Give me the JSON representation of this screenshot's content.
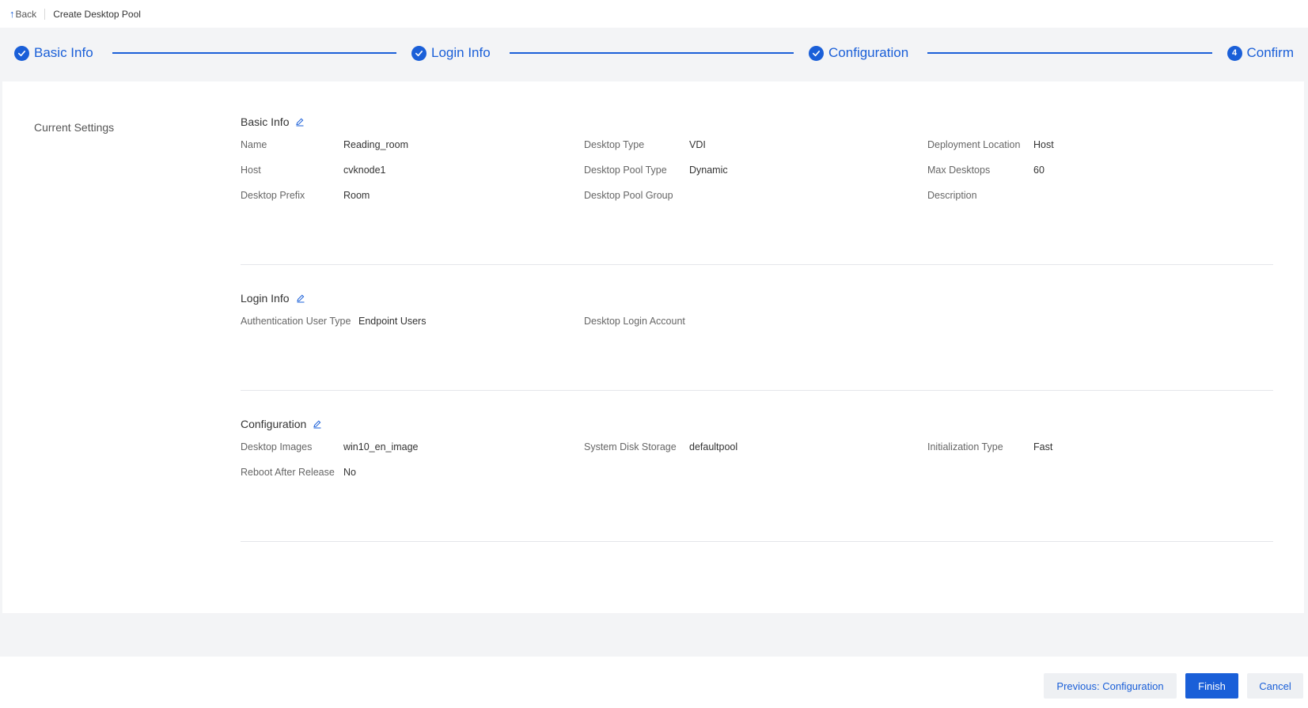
{
  "topbar": {
    "back_label": "Back",
    "page_title": "Create Desktop Pool"
  },
  "steps": [
    {
      "label": "Basic Info",
      "status": "done"
    },
    {
      "label": "Login Info",
      "status": "done"
    },
    {
      "label": "Configuration",
      "status": "done"
    },
    {
      "label": "Confirm",
      "status": "current",
      "number": "4"
    }
  ],
  "side_title": "Current Settings",
  "sections": {
    "basic_info": {
      "title": "Basic Info",
      "name_label": "Name",
      "name_value": "Reading_room",
      "desktop_type_label": "Desktop Type",
      "desktop_type_value": "VDI",
      "deployment_location_label": "Deployment Location",
      "deployment_location_value": "Host",
      "host_label": "Host",
      "host_value": "cvknode1",
      "pool_type_label": "Desktop Pool Type",
      "pool_type_value": "Dynamic",
      "max_desktops_label": "Max Desktops",
      "max_desktops_value": "60",
      "prefix_label": "Desktop Prefix",
      "prefix_value": "Room",
      "pool_group_label": "Desktop Pool Group",
      "pool_group_value": "",
      "description_label": "Description",
      "description_value": ""
    },
    "login_info": {
      "title": "Login Info",
      "auth_type_label": "Authentication User Type",
      "auth_type_value": "Endpoint Users",
      "login_account_label": "Desktop Login Account",
      "login_account_value": ""
    },
    "configuration": {
      "title": "Configuration",
      "images_label": "Desktop Images",
      "images_value": "win10_en_image",
      "disk_label": "System Disk Storage",
      "disk_value": "defaultpool",
      "init_label": "Initialization Type",
      "init_value": "Fast",
      "reboot_label": "Reboot After Release",
      "reboot_value": "No"
    }
  },
  "footer": {
    "prev_label": "Previous: Configuration",
    "finish_label": "Finish",
    "cancel_label": "Cancel"
  },
  "colors": {
    "accent": "#1a5fd8",
    "background": "#f3f4f6"
  }
}
